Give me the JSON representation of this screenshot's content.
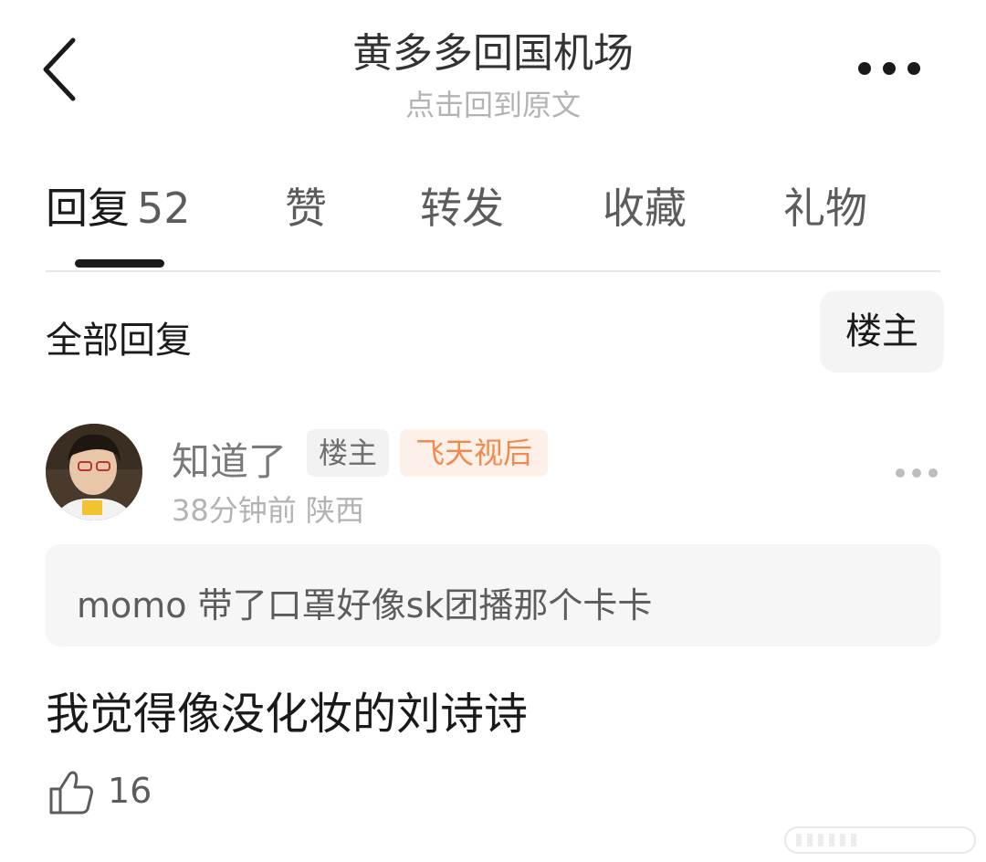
{
  "header": {
    "title": "黄多多回国机场",
    "subtitle": "点击回到原文",
    "back_icon": "chevron-left-icon",
    "more_icon": "more-horizontal-icon"
  },
  "tabs": [
    {
      "label": "回复",
      "count": "52",
      "active": true
    },
    {
      "label": "赞"
    },
    {
      "label": "转发"
    },
    {
      "label": "收藏"
    },
    {
      "label": "礼物"
    }
  ],
  "replies_section": {
    "title": "全部回复",
    "filter_label": "楼主"
  },
  "comment": {
    "username": "知道了",
    "badge_op": "楼主",
    "badge_title": "飞天视后",
    "time": "38分钟前",
    "location": "陕西",
    "quote": "momo 带了口罩好像sk团播那个卡卡",
    "text": "我觉得像没化妆的刘诗诗",
    "like_count": "16",
    "like_icon": "thumbs-up-icon"
  },
  "colors": {
    "accent_orange": "#f28a4b",
    "badge_orange_bg": "#fdf0e8",
    "secondary_text": "#b3b3b3"
  }
}
